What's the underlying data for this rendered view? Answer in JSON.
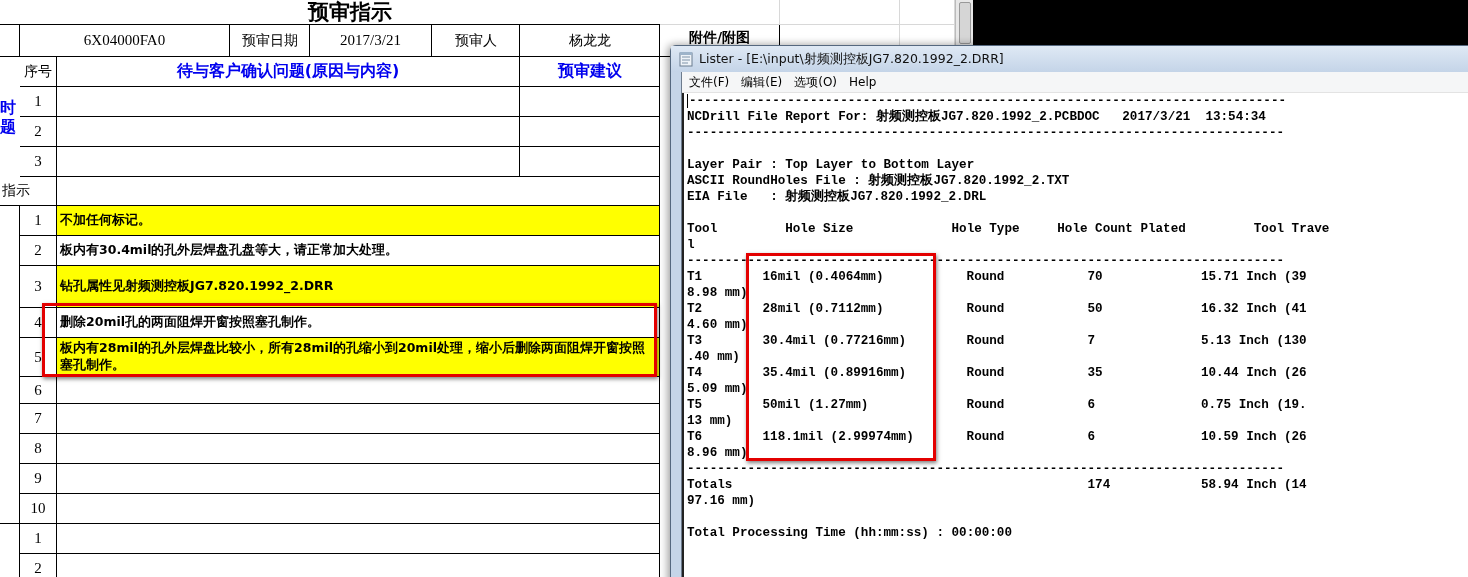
{
  "sheet": {
    "title": "预审指示",
    "header": {
      "order_number": "6X04000FA0",
      "date_label": "预审日期",
      "date": "2017/3/21",
      "reviewer_label": "预审人",
      "reviewer": "杨龙龙",
      "attachment_label": "附件/附图"
    },
    "side_label": "时题",
    "question_header": {
      "number": "序号",
      "question": "待与客户确认问题(原因与内容)",
      "advice": "预审建议"
    },
    "questions": [
      {
        "number": "1"
      },
      {
        "number": "2"
      },
      {
        "number": "3"
      }
    ],
    "instruction_label": "指示",
    "instructions": [
      {
        "number": "1",
        "text": "不加任何标记。",
        "highlighted": true,
        "framed": false
      },
      {
        "number": "2",
        "text": "板内有30.4mil的孔外层焊盘孔盘等大，请正常加大处理。",
        "highlighted": false,
        "framed": false
      },
      {
        "number": "3",
        "text": "钻孔属性见射频测控板JG7.820.1992_2.DRR",
        "highlighted": true,
        "framed": false
      },
      {
        "number": "4",
        "text": "删除20mil孔的两面阻焊开窗按照塞孔制作。",
        "highlighted": false,
        "framed": true
      },
      {
        "number": "5",
        "text": "板内有28mil的孔外层焊盘比较小，所有28mil的孔缩小到20mil处理，缩小后删除两面阻焊开窗按照塞孔制作。",
        "highlighted": true,
        "framed": true
      },
      {
        "number": "6",
        "highlighted": false,
        "framed": false
      },
      {
        "number": "7",
        "highlighted": false,
        "framed": false
      },
      {
        "number": "8",
        "highlighted": false,
        "framed": false
      },
      {
        "number": "9",
        "highlighted": false,
        "framed": false
      },
      {
        "number": "10",
        "highlighted": false,
        "framed": false
      }
    ],
    "next_section": [
      {
        "number": "1"
      },
      {
        "number": "2"
      }
    ]
  },
  "lister": {
    "title": "Lister - [E:\\input\\射频测控板JG7.820.1992_2.DRR]",
    "menu": [
      "文件(F)",
      "编辑(E)",
      "选项(O)",
      "Help"
    ],
    "lines": [
      {
        "kind": "text",
        "text": "-------------------------------------------------------------------------------",
        "cursor": true
      },
      {
        "kind": "text",
        "text": "NCDrill File Report For: 射频测控板JG7.820.1992_2.PCBDOC   2017/3/21  13:54:34",
        "cursor": false
      },
      {
        "kind": "text",
        "text": "-------------------------------------------------------------------------------",
        "cursor": false
      },
      {
        "kind": "blank"
      },
      {
        "kind": "text",
        "text": "Layer Pair : Top Layer to Bottom Layer",
        "cursor": false
      },
      {
        "kind": "text",
        "text": "ASCII RoundHoles File : 射频测控板JG7.820.1992_2.TXT",
        "cursor": false
      },
      {
        "kind": "text",
        "text": "EIA File   : 射频测控板JG7.820.1992_2.DRL",
        "cursor": false
      },
      {
        "kind": "blank"
      },
      {
        "kind": "text",
        "text": "Tool         Hole Size             Hole Type     Hole Count Plated         Tool Trave",
        "cursor": false
      },
      {
        "kind": "text",
        "text": "l",
        "cursor": false
      },
      {
        "kind": "text",
        "text": "-------------------------------------------------------------------------------",
        "cursor": false
      },
      {
        "kind": "row",
        "tool": "T1",
        "hole_size": "16mil (0.4064mm)",
        "hole_type": "Round",
        "hole_count": "70",
        "tool_travel": "15.71 Inch (39",
        "continuation": "8.98 mm)",
        "framed": true
      },
      {
        "kind": "row",
        "tool": "T2",
        "hole_size": "28mil (0.7112mm)",
        "hole_type": "Round",
        "hole_count": "50",
        "tool_travel": "16.32 Inch (41",
        "continuation": "4.60 mm)",
        "framed": true
      },
      {
        "kind": "row",
        "tool": "T3",
        "hole_size": "30.4mil (0.77216mm)",
        "hole_type": "Round",
        "hole_count": "7",
        "tool_travel": "5.13 Inch (130",
        "continuation": ".40 mm)",
        "framed": true
      },
      {
        "kind": "row",
        "tool": "T4",
        "hole_size": "35.4mil (0.89916mm)",
        "hole_type": "Round",
        "hole_count": "35",
        "tool_travel": "10.44 Inch (26",
        "continuation": "5.09 mm)",
        "framed": true
      },
      {
        "kind": "row",
        "tool": "T5",
        "hole_size": "50mil (1.27mm)",
        "hole_type": "Round",
        "hole_count": "6",
        "tool_travel": "0.75 Inch (19.",
        "continuation": "13 mm)",
        "framed": true
      },
      {
        "kind": "row",
        "tool": "T6",
        "hole_size": "118.1mil (2.99974mm)",
        "hole_type": "Round",
        "hole_count": "6",
        "tool_travel": "10.59 Inch (26",
        "continuation": "8.96 mm)",
        "framed": true
      },
      {
        "kind": "text",
        "text": "-------------------------------------------------------------------------------",
        "cursor": false
      },
      {
        "kind": "row",
        "tool": "Totals",
        "hole_count": "174",
        "tool_travel": "58.94 Inch (14",
        "continuation": "97.16 mm)",
        "framed": false
      },
      {
        "kind": "blank"
      },
      {
        "kind": "text",
        "text": "Total Processing Time (hh:mm:ss) : 00:00:00",
        "cursor": false
      }
    ]
  }
}
